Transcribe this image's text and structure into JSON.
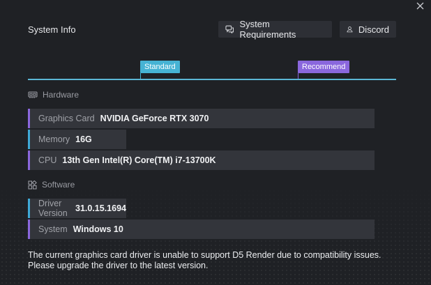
{
  "header": {
    "title": "System Info",
    "requirements_label": "System Requirements",
    "discord_label": "Discord"
  },
  "scale": {
    "standard_label": "Standard",
    "recommend_label": "Recommend",
    "colors": {
      "standard": "#46b3d4",
      "recommend": "#8a67dd"
    }
  },
  "hardware": {
    "heading": "Hardware",
    "items": [
      {
        "label": "Graphics Card",
        "value": "NVIDIA GeForce RTX 3070",
        "tier": "recommend"
      },
      {
        "label": "Memory",
        "value": "16G",
        "tier": "standard"
      },
      {
        "label": "CPU",
        "value": "13th Gen Intel(R) Core(TM) i7-13700K",
        "tier": "recommend"
      }
    ]
  },
  "software": {
    "heading": "Software",
    "items": [
      {
        "label": "Driver Version",
        "value": "31.0.15.1694",
        "tier": "standard"
      },
      {
        "label": "System",
        "value": "Windows 10",
        "tier": "recommend"
      }
    ]
  },
  "notice": {
    "line1": "The current graphics card driver is unable to support D5 Render due to compatibility issues.",
    "line2": "Please upgrade the driver to the latest version."
  },
  "icons": {
    "close": "close-icon",
    "requirements": "chat-bubbles-icon",
    "discord": "user-icon",
    "hardware": "gpu-card-icon",
    "software": "apps-grid-icon"
  }
}
